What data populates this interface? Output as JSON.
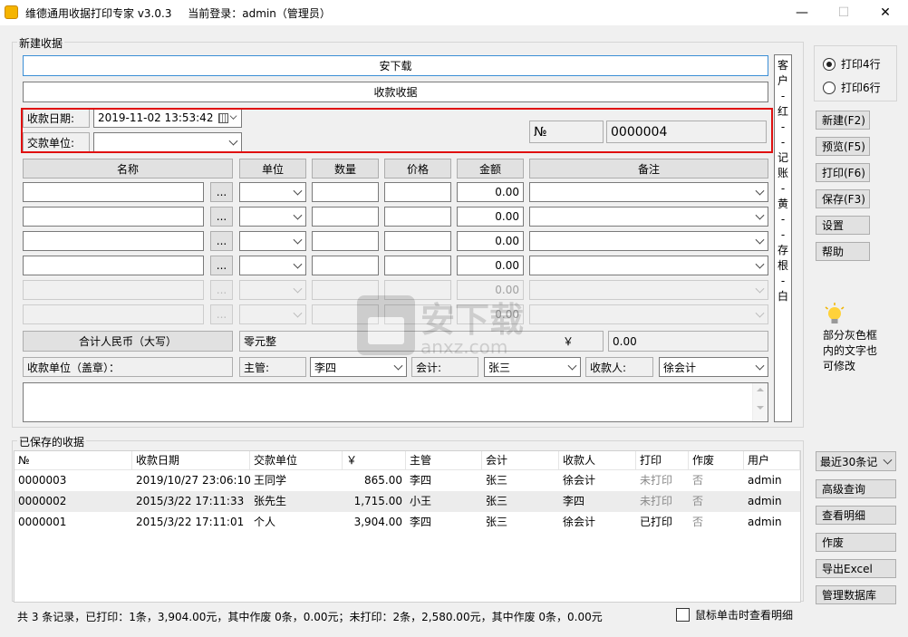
{
  "window": {
    "title": "维德通用收据打印专家 v3.0.3",
    "login_text": "当前登录：admin（管理员）",
    "minimize": "—",
    "maximize": "☐",
    "close": "✕"
  },
  "new_receipt": {
    "group_label": "新建收据",
    "company": "安下载",
    "receipt_title": "收款收据",
    "date_label": "收款日期:",
    "date_value": "2019-11-02 13:53:42",
    "payer_label": "交款单位:",
    "payer_value": "",
    "no_label": "№",
    "no_value": "0000004",
    "columns": {
      "name": "名称",
      "unit": "单位",
      "qty": "数量",
      "price": "价格",
      "amount": "金额",
      "remark": "备注"
    },
    "rows": [
      {
        "amount": "0.00",
        "enabled": true
      },
      {
        "amount": "0.00",
        "enabled": true
      },
      {
        "amount": "0.00",
        "enabled": true
      },
      {
        "amount": "0.00",
        "enabled": true
      },
      {
        "amount": "0.00",
        "enabled": false
      },
      {
        "amount": "0.00",
        "enabled": false
      }
    ],
    "browse_label": "...",
    "total_label": "合计人民币（大写）",
    "total_cn": "零元整",
    "yen_symbol": "￥",
    "total_value": "0.00",
    "payee_unit_label": "收款单位（盖章）：",
    "supervisor_label": "主管:",
    "supervisor_value": "李四",
    "accountant_label": "会计:",
    "accountant_value": "张三",
    "payee_label": "收款人:",
    "payee_value": "徐会计",
    "side_text": [
      "客",
      "户",
      "-",
      "红",
      "-",
      "-",
      "记",
      "账",
      "-",
      "黄",
      "-",
      "-",
      "存",
      "根",
      "-",
      "白"
    ]
  },
  "right_panel": {
    "print4": "打印4行",
    "print6": "打印6行",
    "print_mode_selected": "print4",
    "buttons": [
      "新建(F2)",
      "预览(F5)",
      "打印(F6)",
      "保存(F3)",
      "设置",
      "帮助"
    ],
    "tip": [
      "部分灰色框",
      "内的文字也",
      "可修改"
    ],
    "tip_icon": "lightbulb-icon"
  },
  "saved": {
    "group_label": "已保存的收据",
    "headers": [
      "№",
      "收款日期",
      "交款单位",
      "￥",
      "主管",
      "会计",
      "收款人",
      "打印",
      "作废",
      "用户"
    ],
    "rows": [
      {
        "no": "0000003",
        "date": "2019/10/27 23:06:10",
        "payer": "王同学",
        "amount": "865.00",
        "supervisor": "李四",
        "accountant": "张三",
        "payee": "徐会计",
        "printed": "未打印",
        "void": "否",
        "user": "admin"
      },
      {
        "no": "0000002",
        "date": "2015/3/22 17:11:33",
        "payer": "张先生",
        "amount": "1,715.00",
        "supervisor": "小王",
        "accountant": "张三",
        "payee": "李四",
        "printed": "未打印",
        "void": "否",
        "user": "admin"
      },
      {
        "no": "0000001",
        "date": "2015/3/22 17:11:01",
        "payer": "个人",
        "amount": "3,904.00",
        "supervisor": "李四",
        "accountant": "张三",
        "payee": "徐会计",
        "printed": "已打印",
        "void": "否",
        "user": "admin"
      }
    ],
    "filter_value": "最近30条记",
    "buttons": [
      "高级查询",
      "查看明细",
      "作废",
      "导出Excel",
      "管理数据库"
    ]
  },
  "status": {
    "summary": "共 3 条记录，已打印：1条，3,904.00元，其中作废 0条，0.00元；未打印：2条，2,580.00元，其中作废 0条，0.00元",
    "checkbox_label": "鼠标单击时查看明细"
  },
  "watermark": {
    "text": "安下载",
    "sub": "anxz.com"
  }
}
